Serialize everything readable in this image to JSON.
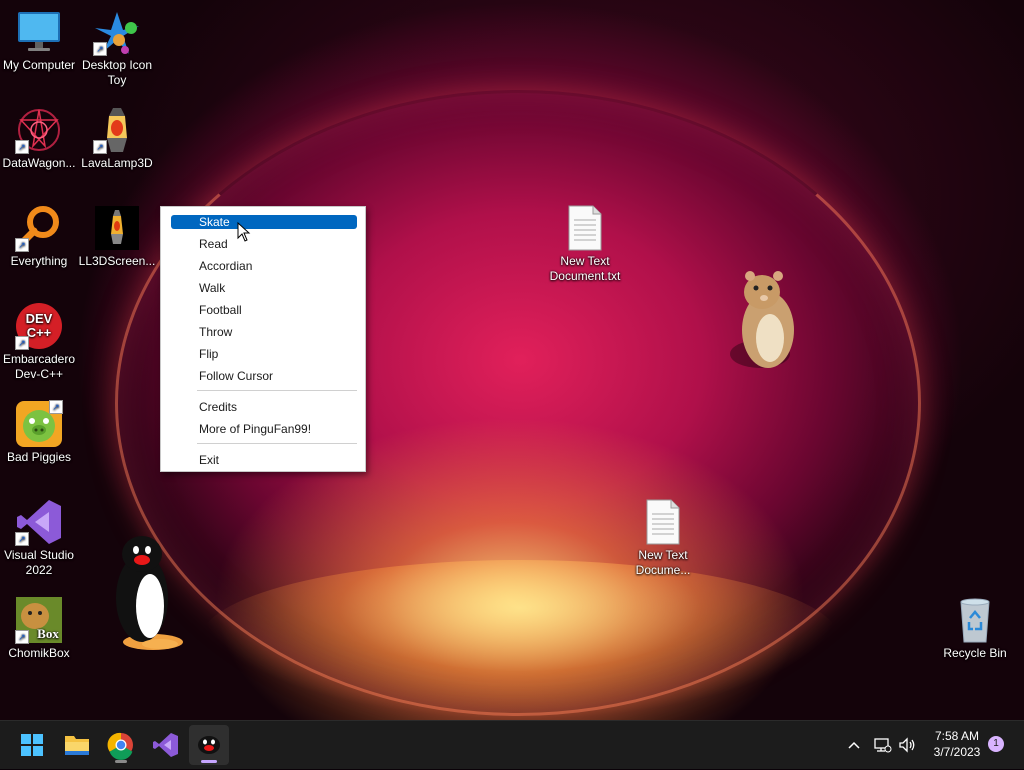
{
  "desktop": {
    "icons": [
      {
        "label": "My Computer"
      },
      {
        "label": "Desktop Icon Toy"
      },
      {
        "label": "DataWagon..."
      },
      {
        "label": "LavaLamp3D"
      },
      {
        "label": "Everything"
      },
      {
        "label": "LL3DScreen..."
      },
      {
        "label": "Embarcadero Dev-C++"
      },
      {
        "label": "Bad Piggies"
      },
      {
        "label": "Visual Studio 2022"
      },
      {
        "label": "ChomikBox"
      },
      {
        "label": "New Text Document.txt"
      },
      {
        "label": "New Text Docume..."
      },
      {
        "label": "Recycle Bin"
      }
    ],
    "devcpp_logo_text": "DEV C++",
    "chomik_logo_text": "Box"
  },
  "context_menu": {
    "selected": "Skate",
    "items": [
      "Skate",
      "Read",
      "Accordian",
      "Walk",
      "Football",
      "Throw",
      "Flip",
      "Follow Cursor"
    ],
    "extras": [
      "Credits",
      "More of PinguFan99!"
    ],
    "exit": "Exit"
  },
  "taskbar": {
    "apps": [
      "start",
      "file-explorer",
      "chrome",
      "visual-studio",
      "pingu"
    ],
    "active_app": "pingu",
    "time": "7:58 AM",
    "date": "3/7/2023",
    "notification_count": "1"
  },
  "colors": {
    "menu_highlight": "#0067c0",
    "taskbar": "#1c1c1c",
    "wallpaper_accent": "#e1205a"
  }
}
